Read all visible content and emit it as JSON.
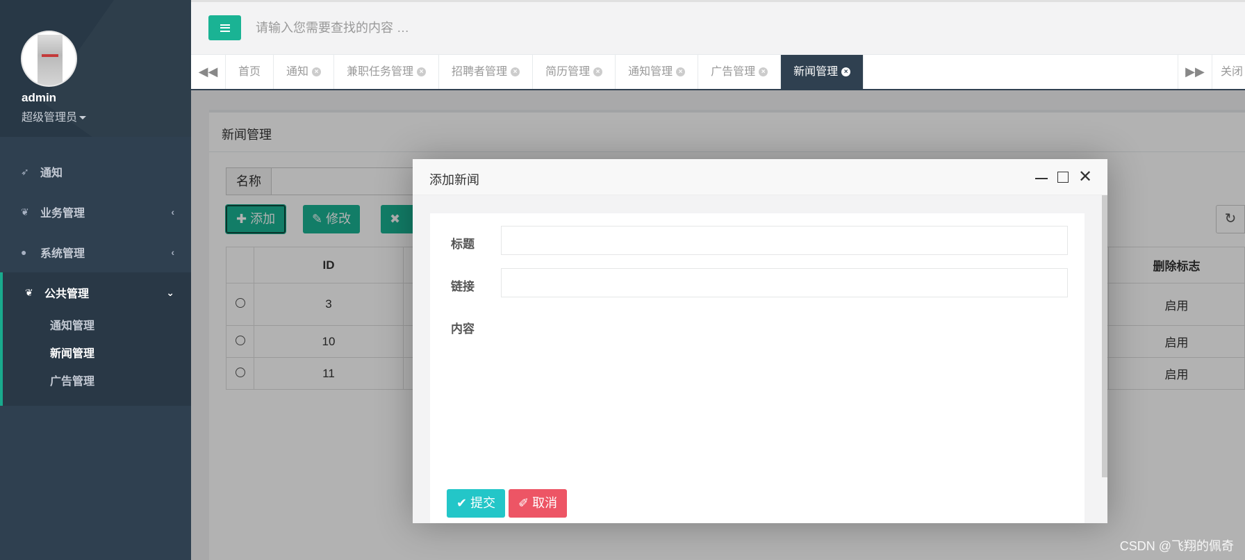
{
  "sidebar": {
    "username": "admin",
    "role": "超级管理员",
    "nav": [
      {
        "label": "通知",
        "icon": "rocket-icon"
      },
      {
        "label": "业务管理",
        "icon": "leaf-icon"
      },
      {
        "label": "系统管理",
        "icon": "user-icon"
      },
      {
        "label": "公共管理",
        "icon": "leaf-icon"
      }
    ],
    "sub_items": [
      "通知管理",
      "新闻管理",
      "广告管理"
    ]
  },
  "topbar": {
    "search_placeholder": "请输入您需要查找的内容 …"
  },
  "tabs": [
    {
      "label": "首页"
    },
    {
      "label": "通知"
    },
    {
      "label": "兼职任务管理"
    },
    {
      "label": "招聘者管理"
    },
    {
      "label": "简历管理"
    },
    {
      "label": "通知管理"
    },
    {
      "label": "广告管理"
    },
    {
      "label": "新闻管理"
    }
  ],
  "close_all_label": "关闭",
  "panel": {
    "title": "新闻管理",
    "filter_label": "名称",
    "buttons": {
      "add": "添加",
      "edit": "修改",
      "delete": "删"
    },
    "table": {
      "headers": {
        "id": "ID",
        "delete_flag": "删除标志"
      },
      "rows": [
        {
          "id": "3",
          "flag": "启用"
        },
        {
          "id": "10",
          "flag": "启用"
        },
        {
          "id": "11",
          "flag": "启用"
        }
      ]
    }
  },
  "modal": {
    "title": "添加新闻",
    "fields": {
      "title": "标题",
      "link": "链接",
      "content": "内容"
    },
    "submit": "提交",
    "cancel": "取消"
  },
  "watermark": "CSDN @飞翔的佩奇",
  "colors": {
    "sidebar": "#2f4050",
    "accent": "#1ab394",
    "submit": "#23c6c8",
    "cancel": "#ed5565"
  }
}
